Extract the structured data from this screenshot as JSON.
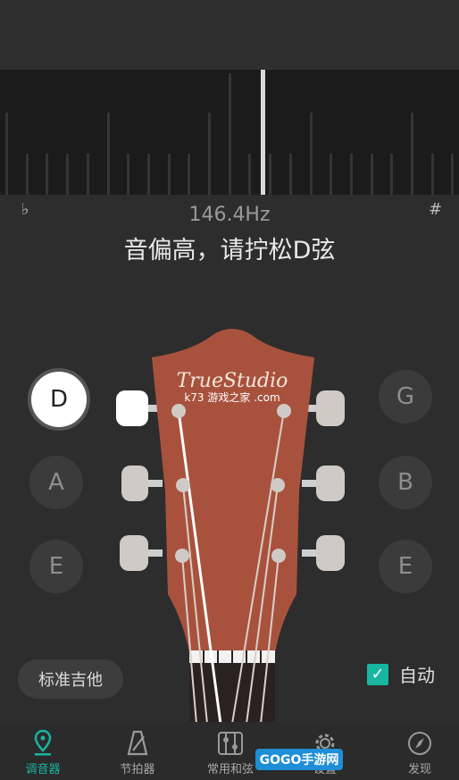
{
  "tuner": {
    "frequency": "146.4Hz",
    "message": "音偏高，请拧松D弦",
    "flat_symbol": "♭",
    "sharp_symbol": "#"
  },
  "strings": {
    "left": [
      "D",
      "A",
      "E"
    ],
    "right": [
      "G",
      "B",
      "E"
    ],
    "active": "D"
  },
  "headstock": {
    "brand": "TrueStudio",
    "watermark": "k73 游戏之家 .com"
  },
  "controls": {
    "preset_label": "标准吉他",
    "auto_label": "自动",
    "auto_checked": true
  },
  "tabs": [
    {
      "label": "调音器",
      "icon": "tuner-icon",
      "active": true
    },
    {
      "label": "节拍器",
      "icon": "metronome-icon",
      "active": false
    },
    {
      "label": "常用和弦",
      "icon": "chord-icon",
      "active": false
    },
    {
      "label": "设置",
      "icon": "gear-icon",
      "active": false
    },
    {
      "label": "发现",
      "icon": "compass-icon",
      "active": false
    }
  ],
  "watermark_badge": "GOGO手游网",
  "colors": {
    "accent": "#18b5a0",
    "headstock": "#a8523d",
    "background": "#2d2d2d"
  }
}
